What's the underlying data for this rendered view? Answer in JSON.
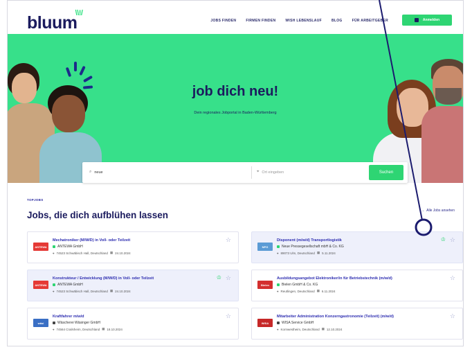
{
  "header": {
    "logo": "bluum",
    "nav": [
      "JOBS FINDEN",
      "FIRMEN FINDEN",
      "WISH LEBENSLAUF",
      "BLOG",
      "FÜR ARBEITGEBER"
    ],
    "login_label": "Anmelden"
  },
  "hero": {
    "title": "job dich neu!",
    "subtitle": "Dein regionales Jobportal in Baden-Württemberg"
  },
  "search": {
    "what_value": "neue",
    "where_placeholder": "Ort eingeben",
    "button_label": "Suchen"
  },
  "jobs_section": {
    "eyebrow": "TOPJOBS",
    "title": "Jobs, die dich aufblühen lassen",
    "all_jobs_label": "Alle Jobs ansehen"
  },
  "jobs": [
    {
      "title": "Mechatroniker (M/W/D) in Voll- oder Teilzeit",
      "company": "ANTEWA GmbH",
      "location": "74523 Schwäbisch Hall, Deutschland",
      "date": "24.10.2024",
      "logo_color": "#e53935",
      "logo_text": "ANTEWA",
      "highlight": false,
      "award": false
    },
    {
      "title": "Disponent (m/w/d) Transportlogistik",
      "company": "Neue Pressegesellschaft mbH & Co. KG",
      "location": "89073 Ulm, Deutschland",
      "date": "5.11.2024",
      "logo_color": "#5b9bd5",
      "logo_text": "NPG",
      "highlight": true,
      "award": true
    },
    {
      "title": "Konstrukteur / Entwicklung (M/W/D) in Voll- oder Teilzeit",
      "company": "ANTEWA GmbH",
      "location": "74523 Schwäbisch Hall, Deutschland",
      "date": "24.10.2024",
      "logo_color": "#e53935",
      "logo_text": "ANTEWA",
      "highlight": true,
      "award": true
    },
    {
      "title": "Ausbildungsangebot Elektroniker/in für Betriebstechnik (m/w/d)",
      "company": "Bielen GmbH & Co. KG",
      "location": "Reutlingen, Deutschland",
      "date": "6.11.2024",
      "logo_color": "#d32f2f",
      "logo_text": "Bielen",
      "highlight": false,
      "award": false
    },
    {
      "title": "Kraftfahrer m/w/d",
      "company": "Wäscherei Wäsinger GmbH",
      "location": "74564 Crailsheim, Deutschland",
      "date": "18.10.2024",
      "logo_color": "#3a6fc4",
      "logo_text": "wäsi",
      "highlight": false,
      "award": false
    },
    {
      "title": "Mitarbeiter Administration Konzerngastronomie (Teilzeit) (m/w/d)",
      "company": "WISA Service GmbH",
      "location": "Kornwestheim, Deutschland",
      "date": "12.10.2024",
      "logo_color": "#c62828",
      "logo_text": "WISA",
      "highlight": false,
      "award": false
    }
  ],
  "colors": {
    "brand_green": "#37e08a",
    "brand_navy": "#1b1b5e",
    "link_blue": "#2d2db0"
  }
}
